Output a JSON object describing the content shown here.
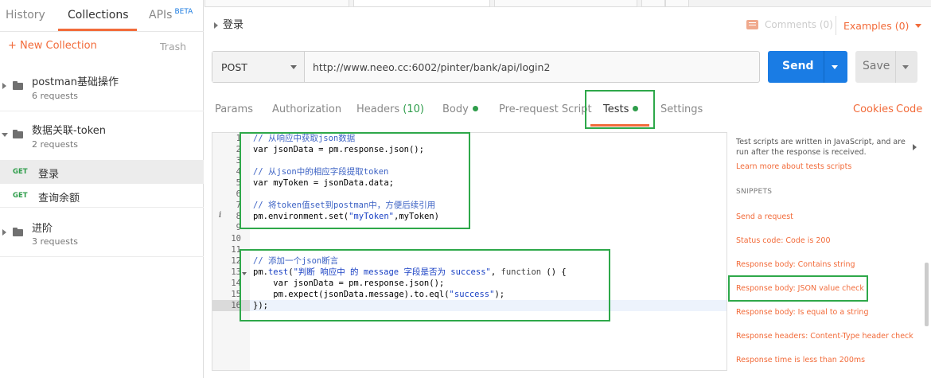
{
  "sidebar": {
    "tabs": [
      {
        "label": "History"
      },
      {
        "label": "Collections"
      },
      {
        "label": "APIs",
        "badge": "BETA"
      }
    ],
    "new_collection": "+ New Collection",
    "trash": "Trash",
    "collections": [
      {
        "name": "postman基础操作",
        "count": "6 requests"
      },
      {
        "name": "数据关联-token",
        "count": "2 requests"
      },
      {
        "name": "进阶",
        "count": "3 requests"
      }
    ],
    "requests": [
      {
        "method": "GET",
        "name": "登录"
      },
      {
        "method": "GET",
        "name": "查询余额"
      }
    ]
  },
  "request": {
    "title": "登录",
    "comments": "Comments (0)",
    "examples": "Examples (0)",
    "method": "POST",
    "url": "http://www.neeo.cc:6002/pinter/bank/api/login2",
    "send": "Send",
    "save": "Save"
  },
  "request_tabs": {
    "params": "Params",
    "authorization": "Authorization",
    "headers": "Headers",
    "headers_count": "(10)",
    "body": "Body",
    "prerequest": "Pre-request Script",
    "tests": "Tests",
    "settings": "Settings",
    "cookies": "Cookies",
    "code": "Code"
  },
  "editor": {
    "line_numbers": [
      "1",
      "2",
      "3",
      "4",
      "5",
      "6",
      "7",
      "8",
      "9",
      "10",
      "11",
      "12",
      "13",
      "14",
      "15",
      "16"
    ],
    "lines": {
      "l1": "// 从响应中获取json数据",
      "l2": "var jsonData = pm.response.json();",
      "l4": "// 从json中的相应字段提取token",
      "l5": "var myToken = jsonData.data;",
      "l7": "// 将token值set到postman中，方便后续引用",
      "l8a": "pm.environment.set(",
      "l8b": "\"myToken\"",
      "l8c": ",myToken)",
      "l12": "// 添加一个json断言",
      "l13a": "pm.",
      "l13b": "test",
      "l13c": "(",
      "l13d": "\"判断 响应中 的 message 字段是否为 success\"",
      "l13e": ", ",
      "l13f": "function",
      "l13g": " () {",
      "l14": "    var jsonData = pm.response.json();",
      "l15a": "    pm.expect(jsonData.message).to.eql(",
      "l15b": "\"success\"",
      "l15c": ");",
      "l16": "});"
    }
  },
  "snippets_panel": {
    "description": "Test scripts are written in JavaScript, and are run after the response is received.",
    "learn_more": "Learn more about tests scripts",
    "header": "SNIPPETS",
    "items": [
      "Send a request",
      "Status code: Code is 200",
      "Response body: Contains string",
      "Response body: JSON value check",
      "Response body: Is equal to a string",
      "Response headers: Content-Type header check",
      "Response time is less than 200ms"
    ]
  },
  "colors": {
    "accent": "#f26b3a",
    "send_blue": "#1a7ce4",
    "highlight_green": "#2ea84a"
  }
}
